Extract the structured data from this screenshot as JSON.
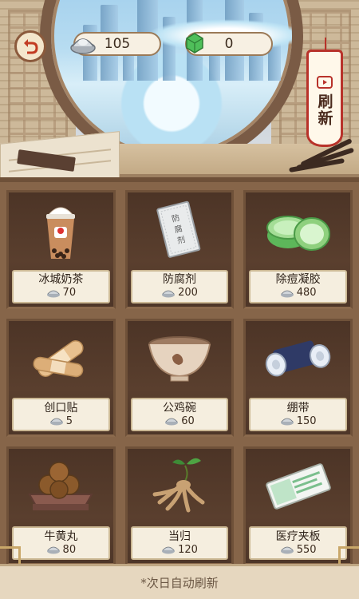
{
  "header": {
    "silver_amount": "105",
    "jade_amount": "0",
    "refresh_label": "刷新"
  },
  "items": [
    {
      "name": "冰城奶茶",
      "price": "70",
      "icon": "milk-tea-icon"
    },
    {
      "name": "防腐剂",
      "price": "200",
      "icon": "preservative-packet-icon"
    },
    {
      "name": "除痘凝胶",
      "price": "480",
      "icon": "gel-jar-icon"
    },
    {
      "name": "创口贴",
      "price": "5",
      "icon": "bandaid-icon"
    },
    {
      "name": "公鸡碗",
      "price": "60",
      "icon": "rooster-bowl-icon"
    },
    {
      "name": "绷带",
      "price": "150",
      "icon": "bandage-roll-icon"
    },
    {
      "name": "牛黄丸",
      "price": "80",
      "icon": "medicine-balls-icon"
    },
    {
      "name": "当归",
      "price": "120",
      "icon": "angelica-root-icon"
    },
    {
      "name": "医疗夹板",
      "price": "550",
      "icon": "medical-splint-icon"
    }
  ],
  "footer": {
    "note": "*次日自动刷新"
  },
  "colors": {
    "shelf": "#866549",
    "cell": "#4c3426",
    "label_bg": "#f5eedf",
    "tag_red": "#b8322a"
  }
}
